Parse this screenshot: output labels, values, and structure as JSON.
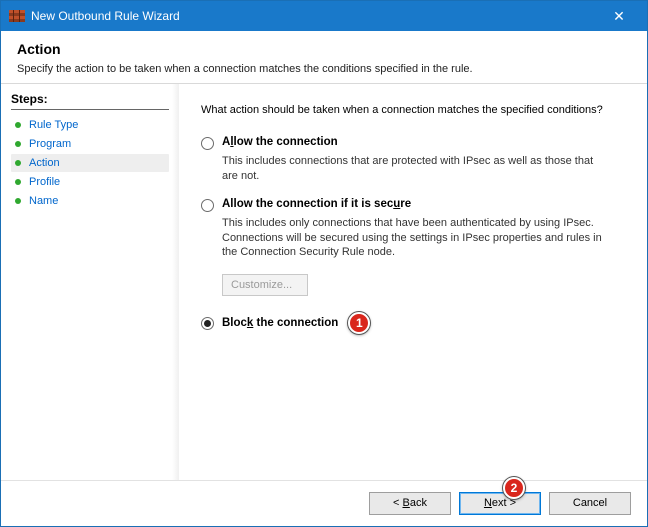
{
  "titlebar": {
    "title": "New Outbound Rule Wizard",
    "close_glyph": "✕"
  },
  "header": {
    "heading": "Action",
    "subtext": "Specify the action to be taken when a connection matches the conditions specified in the rule."
  },
  "sidebar": {
    "heading": "Steps:",
    "items": [
      {
        "label": "Rule Type",
        "current": false
      },
      {
        "label": "Program",
        "current": false
      },
      {
        "label": "Action",
        "current": true
      },
      {
        "label": "Profile",
        "current": false
      },
      {
        "label": "Name",
        "current": false
      }
    ]
  },
  "main": {
    "question": "What action should be taken when a connection matches the specified conditions?",
    "options": {
      "allow": {
        "prefix": "A",
        "underline": "l",
        "suffix": "low the connection",
        "desc": "This includes connections that are protected with IPsec as well as those that are not."
      },
      "allow_secure": {
        "label": "Allow the connection if it is secure",
        "prefix": "Allow the connection if it is sec",
        "underline": "u",
        "suffix": "re",
        "desc": "This includes only connections that have been authenticated by using IPsec. Connections will be secured using the settings in IPsec properties and rules in the Connection Security Rule node.",
        "customize_label": "Customize..."
      },
      "block": {
        "prefix": "Bloc",
        "underline": "k",
        "suffix": " the connection"
      }
    },
    "selected": "block"
  },
  "annotations": {
    "one": "1",
    "two": "2"
  },
  "footer": {
    "back_prefix": "< ",
    "back_ul": "B",
    "back_suffix": "ack",
    "next_prefix": "",
    "next_ul": "N",
    "next_suffix": "ext >",
    "cancel": "Cancel"
  },
  "colors": {
    "accent": "#1979ca",
    "annotation": "#d9261c"
  }
}
